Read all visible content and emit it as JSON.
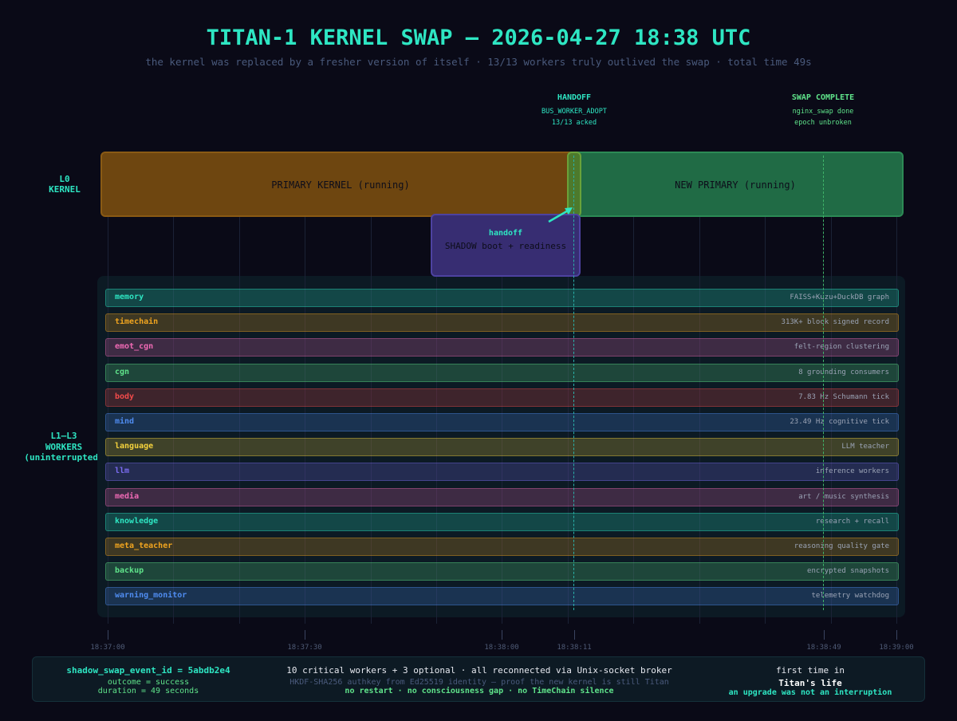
{
  "title": "TITAN-1 KERNEL SWAP — 2026-04-27 18:38 UTC",
  "subtitle": "the kernel was replaced by a fresher version of itself  ·  13/13 workers truly outlived the swap  ·  total time 49s",
  "events": {
    "handoff": {
      "title": "HANDOFF",
      "line1": "BUS_WORKER_ADOPT",
      "line2": "13/13 acked"
    },
    "swap_complete": {
      "title": "SWAP COMPLETE",
      "line1": "nginx_swap done",
      "line2": "epoch unbroken"
    }
  },
  "lanes": {
    "kernel": {
      "line1": "L0",
      "line2": "KERNEL"
    },
    "workers": {
      "line1": "L1–L3",
      "line2": "WORKERS",
      "line3": "(uninterrupted)"
    }
  },
  "bars": {
    "primary": "PRIMARY KERNEL  (running)",
    "new_primary": "NEW PRIMARY  (running)",
    "shadow": "SHADOW  boot + readiness",
    "handoff_label": "handoff"
  },
  "workers": [
    {
      "name": "memory",
      "desc": "FAISS+Kuzu+DuckDB graph",
      "color": "#2ee6c3"
    },
    {
      "name": "timechain",
      "desc": "313K+ block signed record",
      "color": "#f0a41f"
    },
    {
      "name": "emot_cgn",
      "desc": "felt-region clustering",
      "color": "#f06ab5"
    },
    {
      "name": "cgn",
      "desc": "8 grounding consumers",
      "color": "#5fe38a"
    },
    {
      "name": "body",
      "desc": "7.83 Hz Schumann tick",
      "color": "#f24b4b"
    },
    {
      "name": "mind",
      "desc": "23.49 Hz cognitive tick",
      "color": "#4f8cf0"
    },
    {
      "name": "language",
      "desc": "LLM teacher",
      "color": "#f5d23c"
    },
    {
      "name": "llm",
      "desc": "inference workers",
      "color": "#7b6cf0"
    },
    {
      "name": "media",
      "desc": "art / music synthesis",
      "color": "#f06ab5"
    },
    {
      "name": "knowledge",
      "desc": "research + recall",
      "color": "#2ee6c3"
    },
    {
      "name": "meta_teacher",
      "desc": "reasoning quality gate",
      "color": "#f0a41f"
    },
    {
      "name": "backup",
      "desc": "encrypted snapshots",
      "color": "#5fe38a"
    },
    {
      "name": "warning_monitor",
      "desc": "telemetry watchdog",
      "color": "#4f8cf0"
    }
  ],
  "ticks": [
    "18:37:00",
    "18:37:30",
    "18:38:00",
    "18:38:11",
    "18:38:49",
    "18:39:00"
  ],
  "footer": {
    "left": {
      "line1": "shadow_swap_event_id = 5abdb2e4",
      "line2": "outcome = success",
      "line3": "duration = 49 seconds"
    },
    "center": {
      "line1": "10 critical workers + 3 optional · all reconnected via Unix-socket broker",
      "line2": "HKDF-SHA256 authkey from Ed25519 identity — proof the new kernel is still Titan",
      "line3": "no restart · no consciousness gap · no TimeChain silence"
    },
    "right": {
      "line1": "first time in",
      "line2": "Titan's life",
      "line3": "an upgrade was not an interruption"
    }
  },
  "colors": {
    "accent": "#2ee6c3",
    "primary_bar": "#6e4610",
    "new_primary_bar": "#206b45",
    "shadow_bar": "#372d72",
    "success": "#5fe38a"
  }
}
